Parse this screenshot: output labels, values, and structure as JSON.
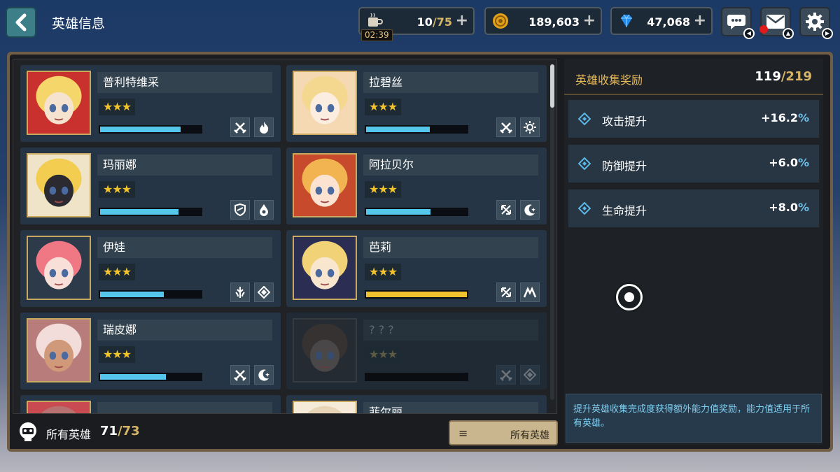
{
  "header": {
    "title": "英雄信息",
    "stamina": {
      "current": "10",
      "max": "/75",
      "timer": "02:39"
    },
    "gold": {
      "value": "189,603"
    },
    "gems": {
      "value": "47,068"
    },
    "plus": "+"
  },
  "colors": {
    "accent_gold": "#d6b566",
    "bar_blue": "#55c7ec",
    "bar_gold": "#f0c22e",
    "star": "#f2c32b"
  },
  "heroes": [
    {
      "name": "普利特维采",
      "stars": "★★★",
      "progress": 0.8,
      "icons": [
        "crossed-swords-icon",
        "fire-icon"
      ],
      "locked": false
    },
    {
      "name": "拉碧丝",
      "stars": "★★★",
      "progress": 0.63,
      "icons": [
        "crossed-swords-icon",
        "sun-icon"
      ],
      "locked": false
    },
    {
      "name": "玛丽娜",
      "stars": "★★★",
      "progress": 0.78,
      "icons": [
        "shield-icon",
        "water-drop-icon"
      ],
      "locked": false
    },
    {
      "name": "阿拉贝尔",
      "stars": "★★★",
      "progress": 0.64,
      "icons": [
        "bow-icon",
        "moon-icon"
      ],
      "locked": false
    },
    {
      "name": "伊娃",
      "stars": "★★★",
      "progress": 0.63,
      "icons": [
        "sword-down-icon",
        "diamond-icon"
      ],
      "locked": false
    },
    {
      "name": "芭莉",
      "stars": "★★★",
      "progress": 1.0,
      "icons": [
        "bow-icon",
        "mountain-icon"
      ],
      "locked": false,
      "gold": true
    },
    {
      "name": "瑞皮娜",
      "stars": "★★★",
      "progress": 0.65,
      "icons": [
        "crossed-swords-icon",
        "moon-icon"
      ],
      "locked": false
    },
    {
      "name": "? ? ?",
      "stars": "★★★",
      "progress": 0,
      "icons": [
        "crossed-swords-icon",
        "diamond-icon"
      ],
      "locked": true
    },
    {
      "name": "",
      "stars": "",
      "progress": 0,
      "icons": [],
      "locked": false
    },
    {
      "name": "菲尔丽",
      "stars": "",
      "progress": 0,
      "icons": [],
      "locked": false
    }
  ],
  "footer": {
    "label": "所有英雄",
    "count": "71",
    "total": "/73",
    "filter_label": "所有英雄",
    "menu_icon": "≡"
  },
  "reward": {
    "title": "英雄收集奖励",
    "count": "119",
    "total": "/219",
    "stats": [
      {
        "name": "攻击提升",
        "value": "+16.2",
        "pct": "%"
      },
      {
        "name": "防御提升",
        "value": "+6.0",
        "pct": "%"
      },
      {
        "name": "生命提升",
        "value": "+8.0",
        "pct": "%"
      }
    ],
    "info": "提升英雄收集完成度获得额外能力值奖励，能力值适用于所有英雄。"
  }
}
